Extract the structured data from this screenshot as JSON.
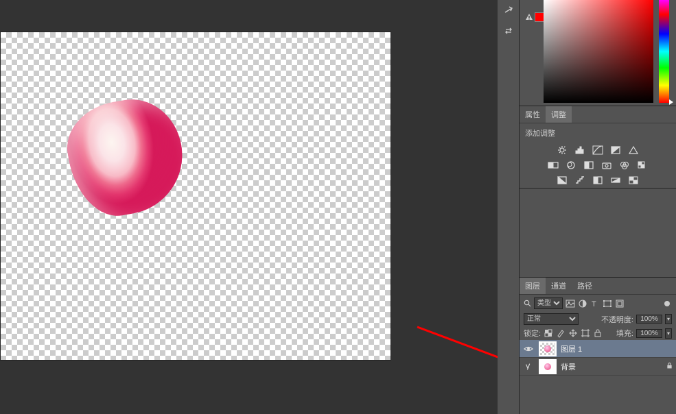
{
  "panels": {
    "properties_tab": "属性",
    "adjustments_tab": "调整",
    "add_adjustment_label": "添加调整",
    "layers_tab": "图层",
    "channels_tab": "通道",
    "paths_tab": "路径"
  },
  "layers_panel": {
    "filter_kind": "类型",
    "blend_mode": "正常",
    "opacity_label": "不透明度:",
    "opacity_value": "100%",
    "lock_label": "锁定:",
    "fill_label": "填充:",
    "fill_value": "100%",
    "layers": [
      {
        "name": "图层 1",
        "visible": true,
        "selected": true,
        "locked": false
      },
      {
        "name": "背景",
        "visible": false,
        "selected": false,
        "locked": true
      }
    ]
  },
  "colors": {
    "foreground": "#ff0000",
    "panel_bg": "#535353",
    "workspace_bg": "#333333"
  }
}
